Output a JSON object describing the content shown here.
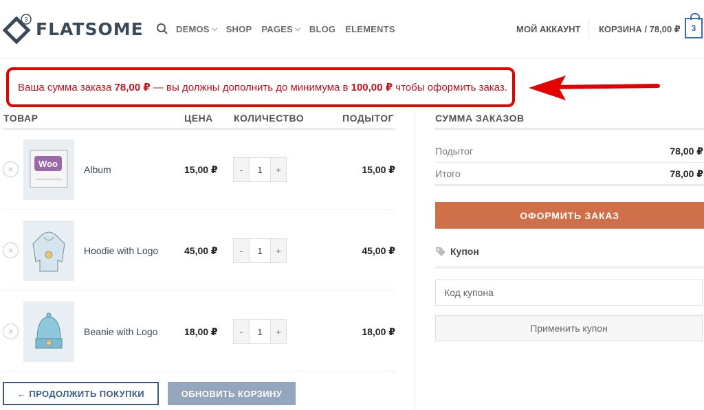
{
  "header": {
    "logo_text": "FLATSOME",
    "logo_badge": "3",
    "nav": [
      {
        "label": "DEMOS",
        "dropdown": true
      },
      {
        "label": "SHOP",
        "dropdown": false
      },
      {
        "label": "PAGES",
        "dropdown": true
      },
      {
        "label": "BLOG",
        "dropdown": false
      },
      {
        "label": "ELEMENTS",
        "dropdown": false
      }
    ],
    "account": "МОЙ АККАУНТ",
    "cart_label": "КОРЗИНА / 78,00 ₽",
    "cart_count": "3",
    "accent_color": "#3b6db5"
  },
  "notice": {
    "part1": "Ваша сумма заказа ",
    "amount": "78,00 ₽",
    "part2": " — вы должны дополнить до минимума в ",
    "minimum": "100,00 ₽",
    "part3": " чтобы оформить заказ.",
    "color": "#e20000"
  },
  "table": {
    "headers": {
      "product": "ТОВАР",
      "price": "ЦЕНА",
      "quantity": "КОЛИЧЕСТВО",
      "subtotal": "ПОДЫТОГ"
    },
    "items": [
      {
        "name": "Album",
        "price": "15,00 ₽",
        "qty": "1",
        "subtotal": "15,00 ₽",
        "icon": "album-icon"
      },
      {
        "name": "Hoodie with Logo",
        "price": "45,00 ₽",
        "qty": "1",
        "subtotal": "45,00 ₽",
        "icon": "hoodie-icon"
      },
      {
        "name": "Beanie with Logo",
        "price": "18,00 ₽",
        "qty": "1",
        "subtotal": "18,00 ₽",
        "icon": "beanie-icon"
      }
    ],
    "remove_glyph": "×",
    "minus": "-",
    "plus": "+"
  },
  "actions": {
    "continue": "← ПРОДОЛЖИТЬ ПОКУПКИ",
    "update": "ОБНОВИТЬ КОРЗИНУ"
  },
  "totals": {
    "title": "СУММА ЗАКАЗОВ",
    "subtotal_label": "Подытог",
    "subtotal_value": "78,00 ₽",
    "total_label": "Итого",
    "total_value": "78,00 ₽",
    "checkout": "ОФОРМИТЬ ЗАКАЗ",
    "checkout_color": "#d0704a"
  },
  "coupon": {
    "title": "Купон",
    "placeholder": "Код купона",
    "apply": "Применить купон"
  }
}
